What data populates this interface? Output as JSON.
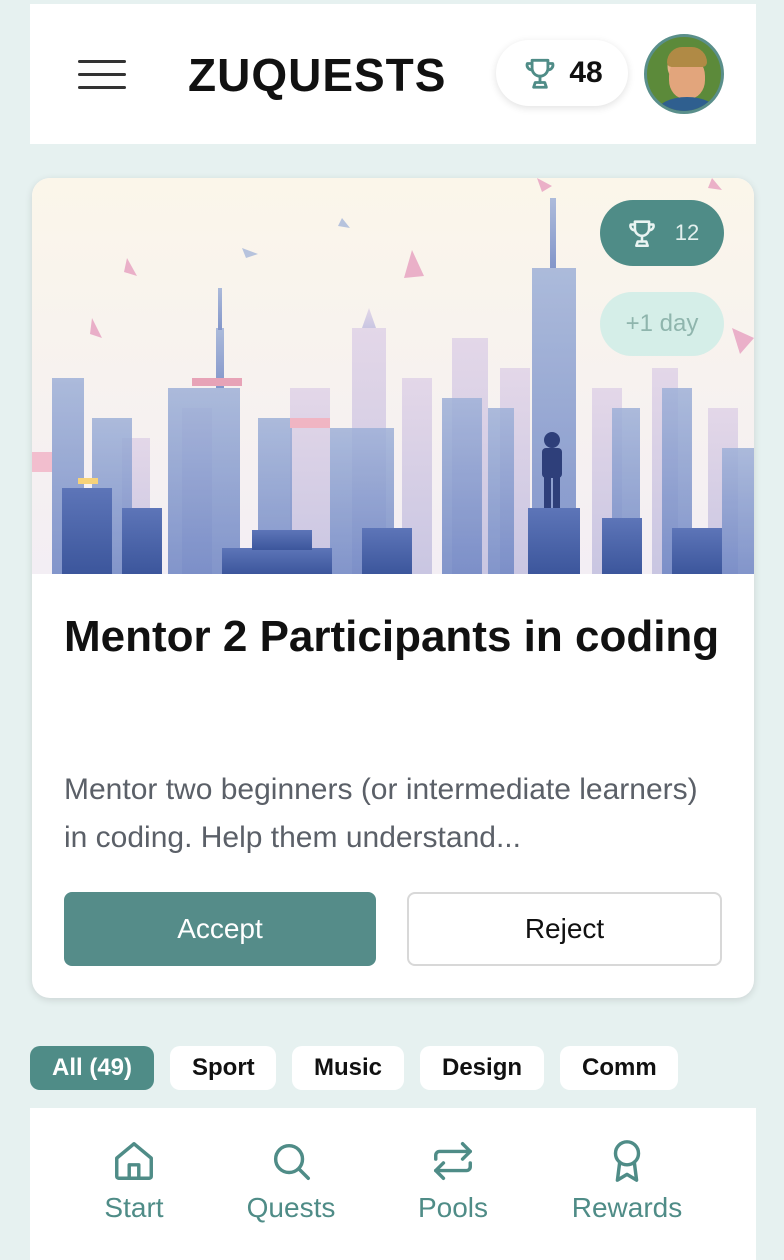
{
  "header": {
    "app_title": "ZUQUESTS",
    "trophy_count": "48",
    "icons": {
      "menu": "hamburger-menu-icon",
      "trophy": "trophy-icon",
      "avatar": "user-avatar"
    }
  },
  "quest_card": {
    "reward_points": "12",
    "duration": "+1 day",
    "title": "Mentor 2 Participants in coding",
    "description": "Mentor two beginners (or intermediate learners) in coding. Help them understand...",
    "accept_label": "Accept",
    "reject_label": "Reject",
    "image": "city-skyline-illustration"
  },
  "filters": [
    {
      "label": "All (49)",
      "active": true
    },
    {
      "label": "Sport",
      "active": false
    },
    {
      "label": "Music",
      "active": false
    },
    {
      "label": "Design",
      "active": false
    },
    {
      "label": "Comm",
      "active": false
    }
  ],
  "bottom_nav": [
    {
      "label": "Start",
      "icon": "home-icon"
    },
    {
      "label": "Quests",
      "icon": "search-icon"
    },
    {
      "label": "Pools",
      "icon": "swap-arrows-icon"
    },
    {
      "label": "Rewards",
      "icon": "award-ribbon-icon"
    }
  ],
  "colors": {
    "accent": "#558c89",
    "background": "#e6f1f0",
    "card": "#ffffff",
    "text_dark": "#111111",
    "text_muted": "#5b6068"
  }
}
